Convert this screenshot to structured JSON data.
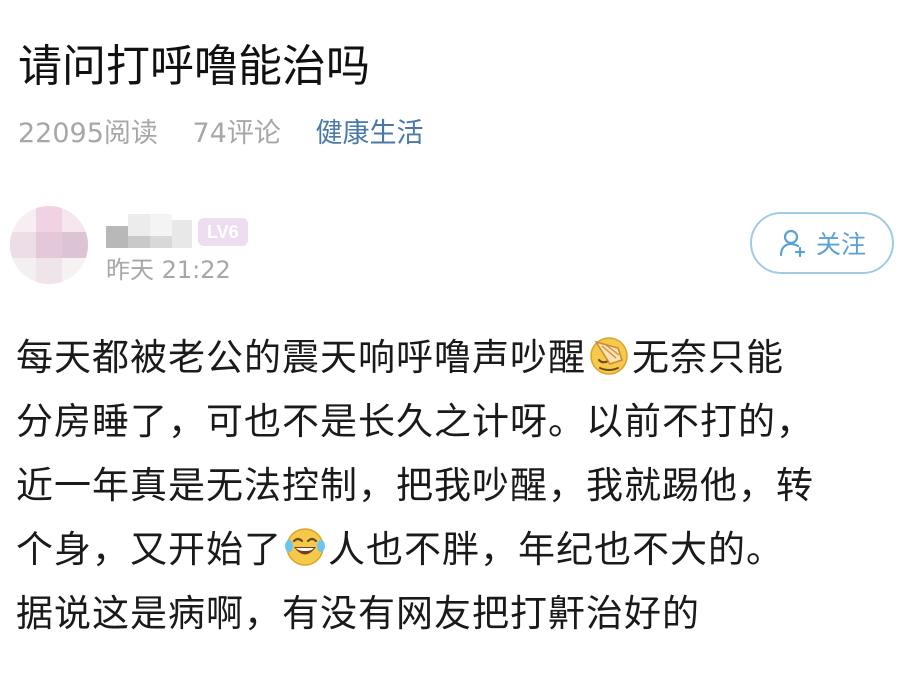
{
  "post": {
    "title": "请问打呼噜能治吗",
    "read_count": "22095阅读",
    "comment_count": "74评论",
    "category": "健康生活"
  },
  "author": {
    "level": "LV6",
    "time": "昨天 21:22",
    "follow_label": "关注"
  },
  "content": {
    "line1_a": "每天都被老公的震天响呼噜声吵醒",
    "emoji1": "facepalm-emoji",
    "line1_b": "无奈只能",
    "line2": "分房睡了，可也不是长久之计呀。以前不打的，",
    "line3": "近一年真是无法控制，把我吵醒，我就踢他，转",
    "line4_a": "个身，又开始了",
    "emoji2": "laughing-tears-emoji",
    "line4_b": "人也不胖，年纪也不大的。",
    "line5": "据说这是病啊，有没有网友把打鼾治好的"
  },
  "colors": {
    "title": "#111111",
    "meta_gray": "#a7a7a7",
    "category_blue": "#4a78a8",
    "follow_blue": "#5aa2d2",
    "badge_pink": "#eedcf0"
  }
}
